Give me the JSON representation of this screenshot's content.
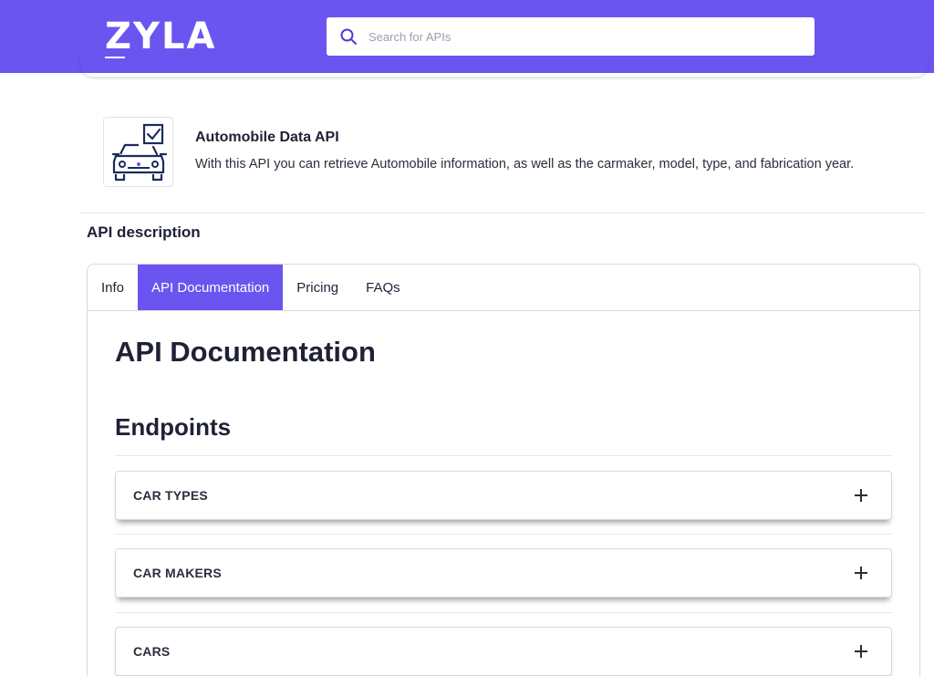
{
  "brand": {
    "logo_text": "ZYLA",
    "accent_color": "#6b55f0"
  },
  "search": {
    "placeholder": "Search for APIs",
    "value": "",
    "icon": "search-icon"
  },
  "api": {
    "icon": "car-checklist-icon",
    "title": "Automobile Data API",
    "description": "With this API you can retrieve Automobile information, as well as the carmaker, model, type, and fabrication year."
  },
  "section_label": "API description",
  "tabs": [
    {
      "label": "Info",
      "active": false
    },
    {
      "label": "API Documentation",
      "active": true
    },
    {
      "label": "Pricing",
      "active": false
    },
    {
      "label": "FAQs",
      "active": false
    }
  ],
  "doc": {
    "title": "API Documentation",
    "endpoints_heading": "Endpoints",
    "endpoints": [
      {
        "label": "CAR TYPES",
        "icon": "plus-icon"
      },
      {
        "label": "CAR MAKERS",
        "icon": "plus-icon"
      },
      {
        "label": "CARS",
        "icon": "plus-icon"
      }
    ]
  }
}
